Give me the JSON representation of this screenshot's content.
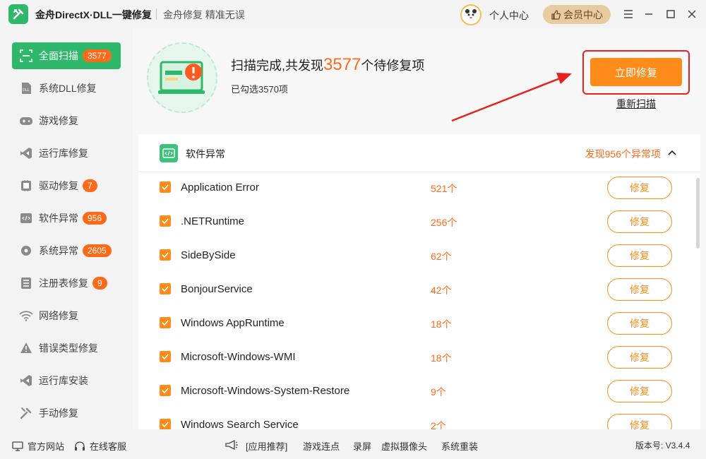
{
  "app": {
    "title": "金舟DirectX·DLL一键修复",
    "slogan": "金舟修复 精准无误",
    "user_center": "个人中心",
    "vip_center": "会员中心"
  },
  "sidebar": {
    "items": [
      {
        "label": "全面扫描",
        "badge": "3577",
        "icon": "scan-icon",
        "active": true
      },
      {
        "label": "系统DLL修复",
        "badge": "",
        "icon": "dll-icon"
      },
      {
        "label": "游戏修复",
        "badge": "",
        "icon": "gamepad-icon"
      },
      {
        "label": "运行库修复",
        "badge": "",
        "icon": "runtime-icon"
      },
      {
        "label": "驱动修复",
        "badge": "7",
        "icon": "driver-icon"
      },
      {
        "label": "软件异常",
        "badge": "956",
        "icon": "code-icon"
      },
      {
        "label": "系统异常",
        "badge": "2605",
        "icon": "gear-icon"
      },
      {
        "label": "注册表修复",
        "badge": "9",
        "icon": "registry-icon"
      },
      {
        "label": "网络修复",
        "badge": "",
        "icon": "wifi-icon"
      },
      {
        "label": "错误类型修复",
        "badge": "",
        "icon": "warning-icon"
      },
      {
        "label": "运行库安装",
        "badge": "",
        "icon": "install-icon"
      },
      {
        "label": "手动修复",
        "badge": "",
        "icon": "wrench-icon"
      }
    ]
  },
  "scan": {
    "title_prefix": "扫描完成,共发现",
    "count": "3577",
    "title_suffix": "个待修复项",
    "selected": "已勾选3570项",
    "fix_all": "立即修复",
    "rescan": "重新扫描"
  },
  "section": {
    "title": "软件异常",
    "found": "发现956个异常项"
  },
  "rows": [
    {
      "name": "Application Error",
      "count": "521个",
      "fix": "修复"
    },
    {
      "name": ".NETRuntime",
      "count": "256个",
      "fix": "修复"
    },
    {
      "name": "SideBySide",
      "count": "62个",
      "fix": "修复"
    },
    {
      "name": "BonjourService",
      "count": "42个",
      "fix": "修复"
    },
    {
      "name": "Windows AppRuntime",
      "count": "18个",
      "fix": "修复"
    },
    {
      "name": "Microsoft-Windows-WMI",
      "count": "18个",
      "fix": "修复"
    },
    {
      "name": "Microsoft-Windows-System-Restore",
      "count": "9个",
      "fix": "修复"
    },
    {
      "name": "Windows Search Service",
      "count": "2个",
      "fix": "修复"
    }
  ],
  "footer": {
    "official_site": "官方网站",
    "online_service": "在线客服",
    "app_recommend": "[应用推荐]",
    "links": [
      "游戏连点",
      "录屏",
      "虚拟摄像头",
      "系统重装"
    ],
    "version": "版本号: V3.4.4"
  },
  "colors": {
    "brand_green": "#2fb86b",
    "accent_orange": "#ff8c1a",
    "highlight_red": "#e8211c"
  }
}
